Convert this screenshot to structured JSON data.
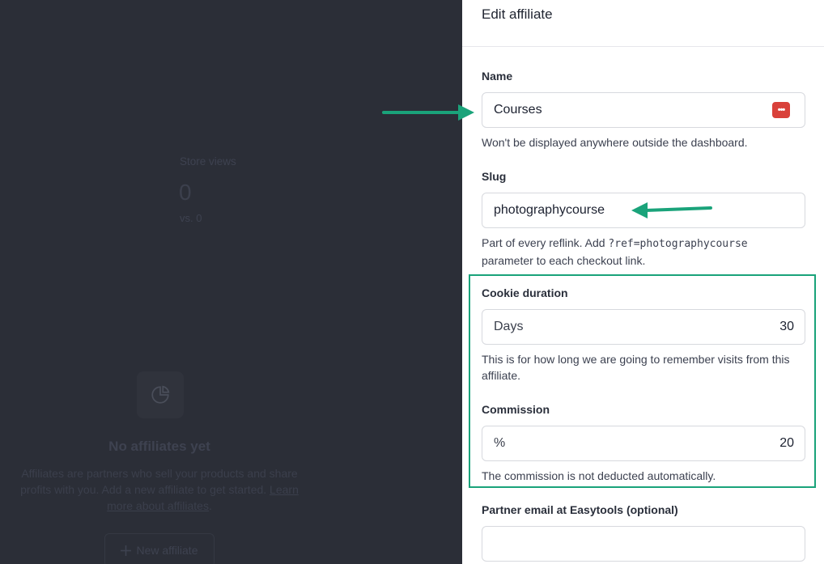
{
  "dashboard": {
    "stat_label": "Store views",
    "stat_value": "0",
    "stat_compare": "vs. 0",
    "empty_icon": "pie-chart-icon",
    "empty_title": "No affiliates yet",
    "empty_desc_text": "Affiliates are partners who sell your products and share profits with you. Add a new affiliate to get started.",
    "empty_desc_link": "Learn more about affiliates",
    "empty_desc_end": ".",
    "new_affiliate_label": "New affiliate",
    "new_affiliate_icon": "plus-icon"
  },
  "panel": {
    "title": "Edit affiliate",
    "name": {
      "label": "Name",
      "value": "Courses",
      "help": "Won't be displayed anywhere outside the dashboard.",
      "icon": "password-manager-icon"
    },
    "slug": {
      "label": "Slug",
      "value": "photographycourse",
      "help_prefix": "Part of every reflink. Add",
      "help_code": "?ref=photographycourse",
      "help_suffix": "parameter to each checkout link."
    },
    "cookie": {
      "label": "Cookie duration",
      "unit": "Days",
      "value": "30",
      "help": "This is for how long we are going to remember visits from this affiliate."
    },
    "commission": {
      "label": "Commission",
      "unit": "%",
      "value": "20",
      "help": "The commission is not deducted automatically."
    },
    "partner_email": {
      "label": "Partner email at Easytools (optional)",
      "value": ""
    }
  },
  "annotations": {
    "arrow_color": "#1aa37a",
    "highlight_color": "#1aa37a"
  }
}
